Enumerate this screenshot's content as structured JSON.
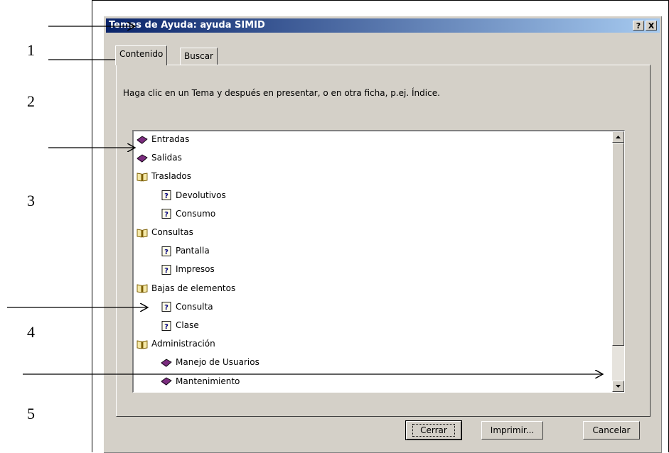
{
  "side_numbers": [
    "1",
    "2",
    "3",
    "4",
    "5"
  ],
  "dialog": {
    "title": "Temas de Ayuda: ayuda SIMID",
    "help_button": "?",
    "close_button": "X"
  },
  "tabs": [
    {
      "label": "Contenido",
      "active": true
    },
    {
      "label": "Buscar",
      "active": false
    }
  ],
  "instruction": "Haga clic en un Tema y después en presentar, o en otra ficha, p.ej. Índice.",
  "tree": [
    {
      "label": "Entradas",
      "icon": "closed-book-icon",
      "level": 0
    },
    {
      "label": "Salidas",
      "icon": "closed-book-icon",
      "level": 0
    },
    {
      "label": "Traslados",
      "icon": "open-book-icon",
      "level": 0
    },
    {
      "label": "Devolutivos",
      "icon": "help-page-icon",
      "level": 1
    },
    {
      "label": "Consumo",
      "icon": "help-page-icon",
      "level": 1
    },
    {
      "label": "Consultas",
      "icon": "open-book-icon",
      "level": 0
    },
    {
      "label": "Pantalla",
      "icon": "help-page-icon",
      "level": 1
    },
    {
      "label": "Impresos",
      "icon": "help-page-icon",
      "level": 1
    },
    {
      "label": "Bajas de elementos",
      "icon": "open-book-icon",
      "level": 0
    },
    {
      "label": "Consulta",
      "icon": "help-page-icon",
      "level": 1
    },
    {
      "label": "Clase",
      "icon": "help-page-icon",
      "level": 1
    },
    {
      "label": "Administración",
      "icon": "open-book-icon",
      "level": 0
    },
    {
      "label": "Manejo de Usuarios",
      "icon": "closed-book-icon",
      "level": 1
    },
    {
      "label": "Mantenimiento",
      "icon": "closed-book-icon",
      "level": 1
    }
  ],
  "buttons": {
    "close": "Cerrar",
    "print": "Imprimir...",
    "cancel": "Cancelar"
  },
  "colors": {
    "titlebar_start": "#0a246a",
    "titlebar_end": "#a6caf0",
    "book_purple": "#7b2c7f"
  }
}
